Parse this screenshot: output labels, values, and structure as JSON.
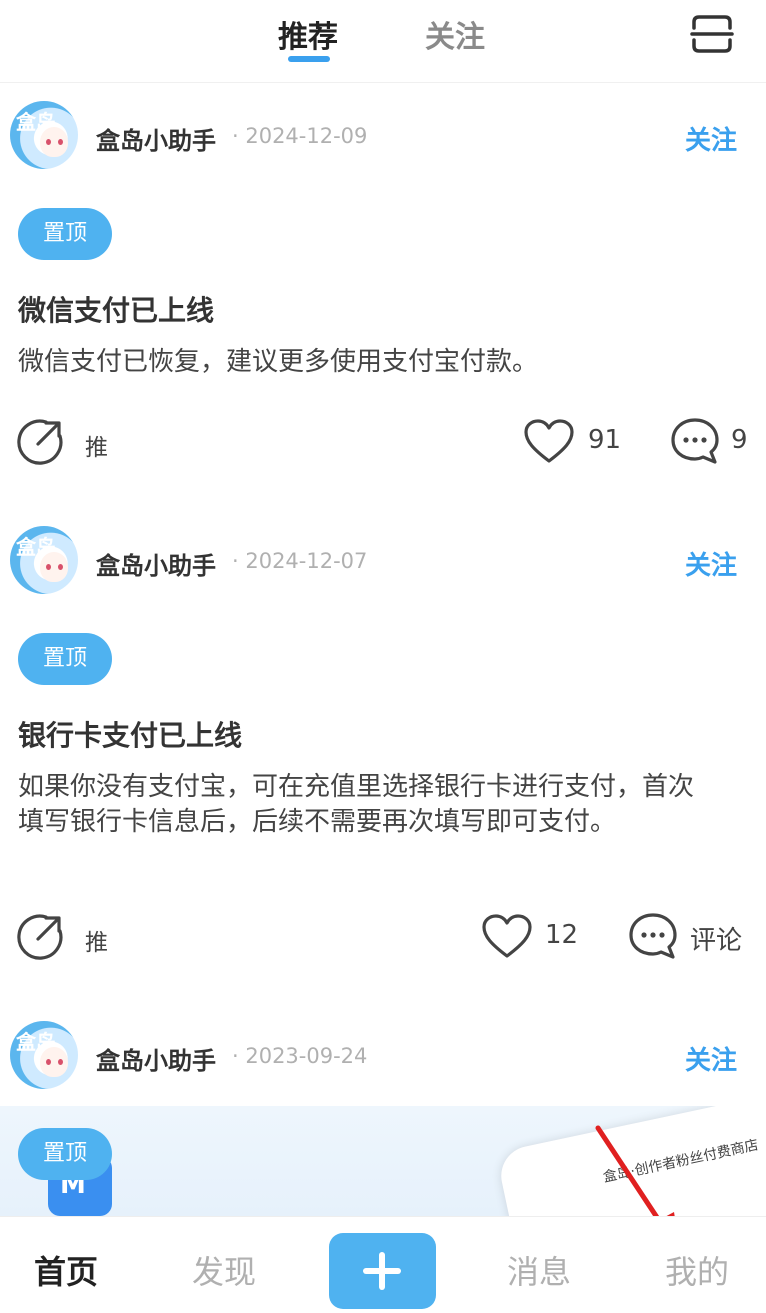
{
  "tabs": {
    "active": "推荐",
    "inactive": "关注"
  },
  "posts": [
    {
      "author": "盒岛小助手",
      "date": "· 2024-12-09",
      "follow_label": "关注",
      "pin_label": "置顶",
      "title": "微信支付已上线",
      "body": "微信支付已恢复，建议更多使用支付宝付款。",
      "share_label": "推",
      "likes": "91",
      "comments": "9"
    },
    {
      "author": "盒岛小助手",
      "date": "· 2024-12-07",
      "follow_label": "关注",
      "pin_label": "置顶",
      "title": "银行卡支付已上线",
      "body": "如果你没有支付宝，可在充值里选择银行卡进行支付，首次填写银行卡信息后，后续不需要再次填写即可支付。",
      "share_label": "推",
      "likes": "12",
      "comments": "评论"
    },
    {
      "author": "盒岛小助手",
      "date": "· 2023-09-24",
      "follow_label": "关注",
      "pin_label": "置顶",
      "image_text": "盒岛·创作者粉丝付费商店"
    }
  ],
  "avatar_mark": "盒岛",
  "app_icon_mark": "M",
  "bottom_nav": {
    "home": "首页",
    "discover": "发现",
    "messages": "消息",
    "mine": "我的"
  },
  "colors": {
    "accent": "#3aa0ee",
    "badge": "#4fb2f0",
    "arrow": "#e02020"
  }
}
